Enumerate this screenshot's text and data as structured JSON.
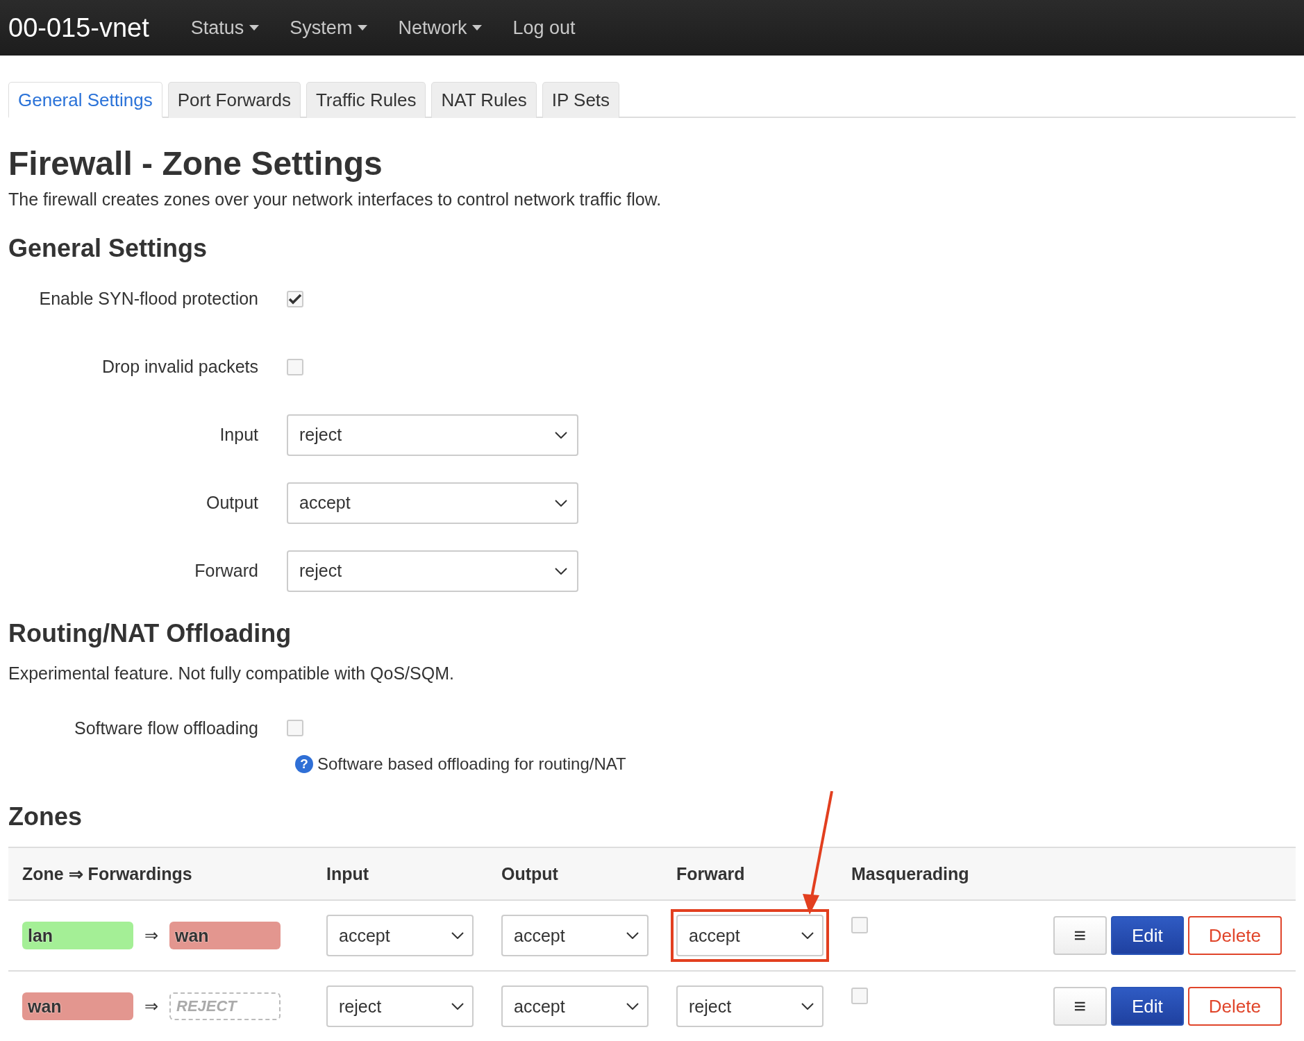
{
  "brand": "00-015-vnet",
  "nav": [
    {
      "label": "Status",
      "dropdown": true
    },
    {
      "label": "System",
      "dropdown": true
    },
    {
      "label": "Network",
      "dropdown": true
    },
    {
      "label": "Log out",
      "dropdown": false
    }
  ],
  "tabs": [
    {
      "label": "General Settings",
      "selected": true
    },
    {
      "label": "Port Forwards",
      "selected": false
    },
    {
      "label": "Traffic Rules",
      "selected": false
    },
    {
      "label": "NAT Rules",
      "selected": false
    },
    {
      "label": "IP Sets",
      "selected": false
    }
  ],
  "page": {
    "title": "Firewall - Zone Settings",
    "description": "The firewall creates zones over your network interfaces to control network traffic flow."
  },
  "general_settings": {
    "heading": "General Settings",
    "fields": [
      {
        "kind": "checkbox",
        "label": "Enable SYN-flood protection",
        "checked": true
      },
      {
        "kind": "checkbox",
        "label": "Drop invalid packets",
        "checked": false
      },
      {
        "kind": "select",
        "label": "Input",
        "value": "reject"
      },
      {
        "kind": "select",
        "label": "Output",
        "value": "accept"
      },
      {
        "kind": "select",
        "label": "Forward",
        "value": "reject"
      }
    ]
  },
  "offloading": {
    "heading": "Routing/NAT Offloading",
    "description": "Experimental feature. Not fully compatible with QoS/SQM.",
    "fields": [
      {
        "kind": "checkbox",
        "label": "Software flow offloading",
        "checked": false,
        "help_icon": "?",
        "help": "Software based offloading for routing/NAT"
      }
    ]
  },
  "zones": {
    "heading": "Zones",
    "columns": [
      "Zone ⇒ Forwardings",
      "Input",
      "Output",
      "Forward",
      "Masquerading"
    ],
    "rows": [
      {
        "zone": {
          "name": "lan",
          "color": "#a4ef96"
        },
        "arrow": "⇒",
        "forward_to": {
          "kind": "zone",
          "name": "wan",
          "color": "#e3968f"
        },
        "input": "accept",
        "output": "accept",
        "forward": "accept",
        "forward_highlighted": true,
        "masquerading": false,
        "buttons": [
          {
            "kind": "menu",
            "label": "≡"
          },
          {
            "kind": "primary",
            "label": "Edit"
          },
          {
            "kind": "danger",
            "label": "Delete"
          }
        ]
      },
      {
        "zone": {
          "name": "wan",
          "color": "#e3968f"
        },
        "arrow": "⇒",
        "forward_to": {
          "kind": "policy",
          "name": "REJECT"
        },
        "input": "reject",
        "output": "accept",
        "forward": "reject",
        "forward_highlighted": false,
        "masquerading": false,
        "buttons": [
          {
            "kind": "menu",
            "label": "≡"
          },
          {
            "kind": "primary",
            "label": "Edit"
          },
          {
            "kind": "danger",
            "label": "Delete"
          }
        ]
      }
    ]
  }
}
